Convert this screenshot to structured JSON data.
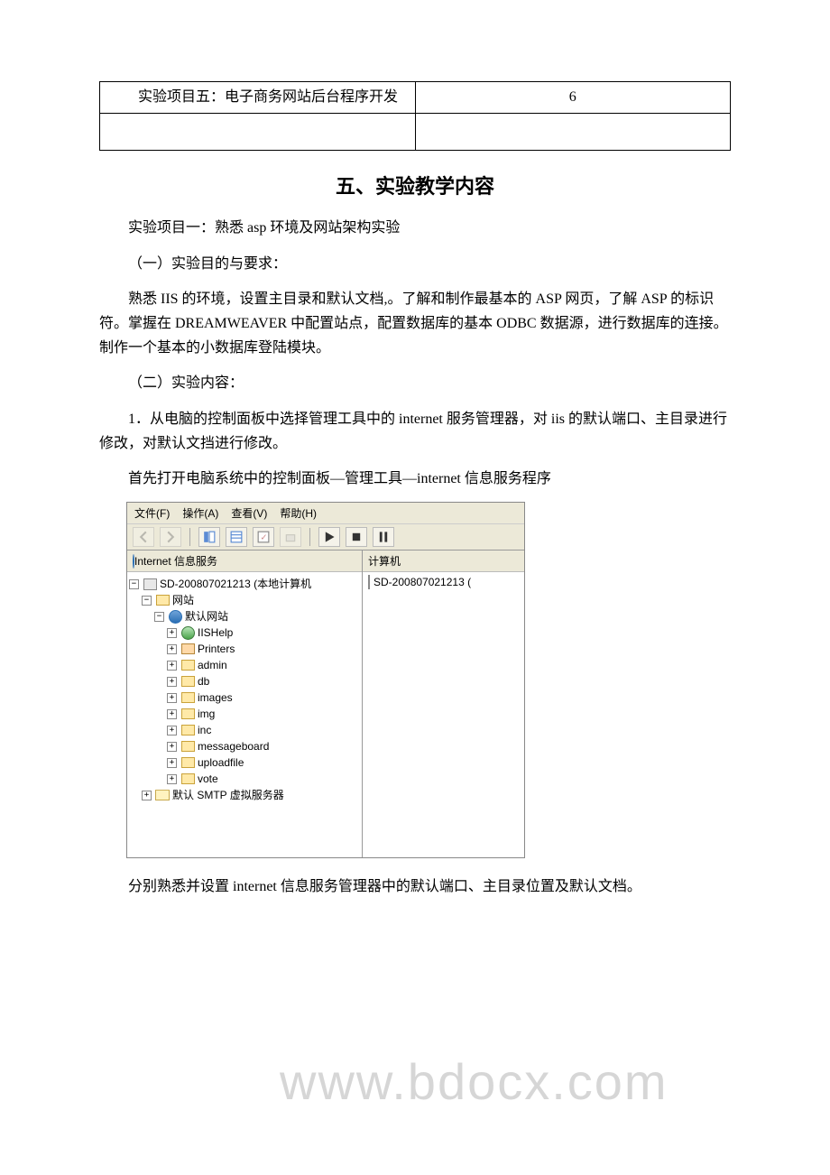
{
  "table": {
    "row1_left": "实验项目五：电子商务网站后台程序开发",
    "row1_right": "6",
    "row2_left": "",
    "row2_right": ""
  },
  "heading": "五、实验教学内容",
  "p1": "实验项目一：熟悉 asp 环境及网站架构实验",
  "p2": "（一）实验目的与要求：",
  "p3": "熟悉 IIS 的环境，设置主目录和默认文档,。了解和制作最基本的 ASP 网页，了解 ASP 的标识符。掌握在 DREAMWEAVER 中配置站点，配置数据库的基本 ODBC 数据源，进行数据库的连接。制作一个基本的小数据库登陆模块。",
  "p4": "（二）实验内容：",
  "p5": "1．从电脑的控制面板中选择管理工具中的 internet 服务管理器，对 iis 的默认端口、主目录进行修改，对默认文挡进行修改。",
  "p6": "首先打开电脑系统中的控制面板—管理工具—internet 信息服务程序",
  "p7": "分别熟悉并设置 internet 信息服务管理器中的默认端口、主目录位置及默认文档。",
  "watermark": "www.bdocx.com",
  "iis": {
    "menus": {
      "file": "文件(F)",
      "action": "操作(A)",
      "view": "查看(V)",
      "help": "帮助(H)"
    },
    "tree_header": "Internet 信息服务",
    "list_header": "计算机",
    "root": "SD-200807021213 (本地计算机",
    "list_item": "SD-200807021213 (",
    "nodes": {
      "website": "网站",
      "default_site": "默认网站",
      "iishelp": "IISHelp",
      "printers": "Printers",
      "admin": "admin",
      "db": "db",
      "images": "images",
      "img": "img",
      "inc": "inc",
      "messageboard": "messageboard",
      "uploadfile": "uploadfile",
      "vote": "vote",
      "smtp": "默认 SMTP 虚拟服务器"
    }
  }
}
